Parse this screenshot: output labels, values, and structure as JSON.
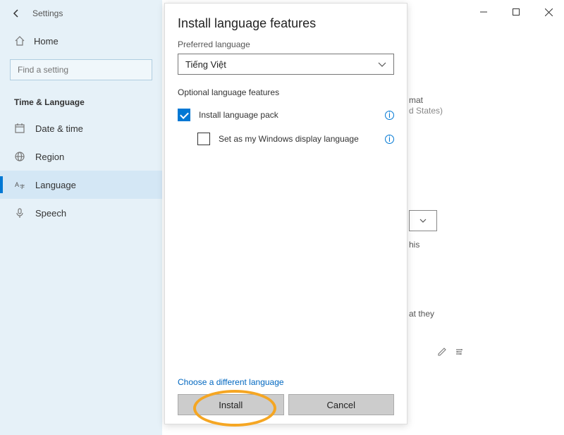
{
  "header": {
    "app_title": "Settings"
  },
  "sidebar": {
    "home_label": "Home",
    "search_placeholder": "Find a setting",
    "category_title": "Time & Language",
    "items": [
      {
        "label": "Date & time",
        "icon": "calendar-icon"
      },
      {
        "label": "Region",
        "icon": "globe-icon"
      },
      {
        "label": "Language",
        "icon": "language-icon",
        "active": true
      },
      {
        "label": "Speech",
        "icon": "microphone-icon"
      }
    ]
  },
  "dialog": {
    "title": "Install language features",
    "preferred_language_label": "Preferred language",
    "language_value": "Tiếng Việt",
    "optional_features_label": "Optional language features",
    "option1_label": "Install language pack",
    "option1_checked": true,
    "option2_label": "Set as my Windows display language",
    "option2_checked": false,
    "choose_different_label": "Choose a different language",
    "install_button": "Install",
    "cancel_button": "Cancel"
  },
  "background": {
    "fragment1": "mat",
    "fragment2": "d States)",
    "fragment3": "his",
    "fragment4": "at they"
  }
}
